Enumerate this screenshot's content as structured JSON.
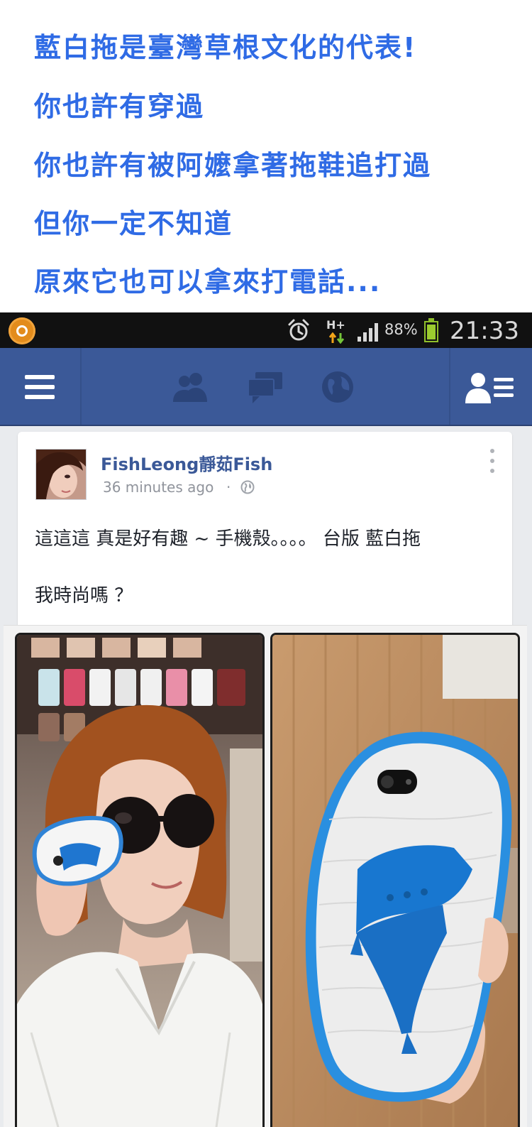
{
  "caption": {
    "lines": [
      "藍白拖是臺灣草根文化的代表!",
      "你也許有穿過",
      "你也許有被阿嬤拿著拖鞋追打過",
      "但你一定不知道",
      "原來它也可以拿來打電話..."
    ],
    "color": "#2f6be5"
  },
  "status_bar": {
    "network": "H+",
    "battery_level": 0.88,
    "battery_text": "88%",
    "time": "21:33",
    "icons": [
      "notification-app-icon",
      "alarm-clock-icon",
      "data-network-icon",
      "signal-strength-icon",
      "battery-icon"
    ]
  },
  "nav": {
    "background": "#3b5998",
    "icons": [
      "menu-icon",
      "friend-requests-icon",
      "messages-icon",
      "notifications-globe-icon",
      "contacts-icon"
    ]
  },
  "post": {
    "author": "FishLeong靜茹Fish",
    "timestamp": "36 minutes ago",
    "separator": "·",
    "privacy_icon": "public-globe-icon",
    "text_line_1": "這這這 真是好有趣 ~ 手機殼。。。。 台版 藍白拖",
    "text_line_2": "我時尚嗎 ？",
    "photos": [
      "woman-holding-slipper-phone-case-photo",
      "slipper-phone-case-closeup-photo"
    ]
  }
}
